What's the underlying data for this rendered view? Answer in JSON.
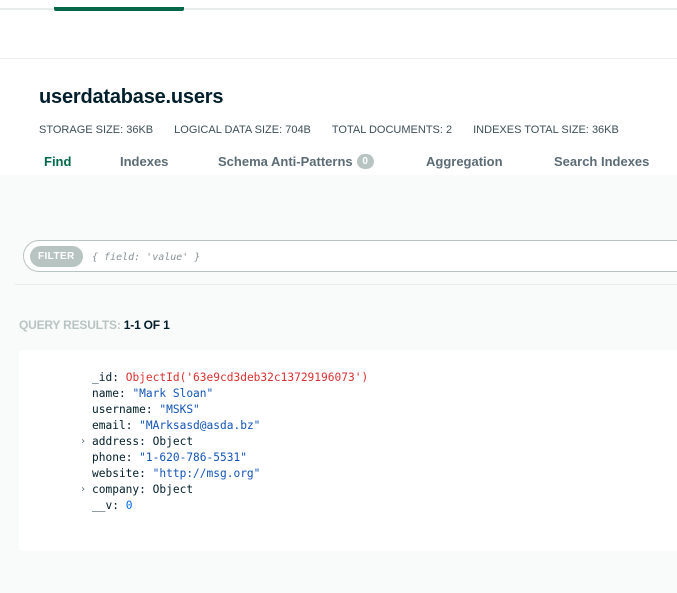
{
  "collection": {
    "namespace": "userdatabase.users",
    "stats": [
      {
        "label": "STORAGE SIZE:",
        "value": "36KB"
      },
      {
        "label": "LOGICAL DATA SIZE:",
        "value": "704B"
      },
      {
        "label": "TOTAL DOCUMENTS:",
        "value": "2"
      },
      {
        "label": "INDEXES TOTAL SIZE:",
        "value": "36KB"
      }
    ]
  },
  "tabs": [
    {
      "label": "Find",
      "active": true
    },
    {
      "label": "Indexes",
      "active": false
    },
    {
      "label": "Schema Anti-Patterns",
      "badge": "0",
      "active": false
    },
    {
      "label": "Aggregation",
      "active": false
    },
    {
      "label": "Search Indexes",
      "active": false
    }
  ],
  "filter": {
    "label": "FILTER",
    "placeholder": "{ field: 'value' }"
  },
  "results": {
    "label": "QUERY RESULTS:",
    "count": "1-1 OF 1"
  },
  "document": {
    "fields": [
      {
        "key": "_id",
        "value": "ObjectId('63e9cd3deb32c13729196073')",
        "kind": "objectid",
        "expandable": false
      },
      {
        "key": "name",
        "value": "\"Mark Sloan\"",
        "kind": "string",
        "expandable": false
      },
      {
        "key": "username",
        "value": "\"MSKS\"",
        "kind": "string",
        "expandable": false
      },
      {
        "key": "email",
        "value": "\"MArksasd@asda.bz\"",
        "kind": "string",
        "expandable": false
      },
      {
        "key": "address",
        "value": "Object",
        "kind": "object",
        "expandable": true
      },
      {
        "key": "phone",
        "value": "\"1-620-786-5531\"",
        "kind": "string",
        "expandable": false
      },
      {
        "key": "website",
        "value": "\"http://msg.org\"",
        "kind": "string",
        "expandable": false
      },
      {
        "key": "company",
        "value": "Object",
        "kind": "object",
        "expandable": true
      },
      {
        "key": "__v",
        "value": "0",
        "kind": "number",
        "expandable": false
      }
    ]
  },
  "colors": {
    "accent": "#00684a",
    "string": "#1254b7",
    "objectid": "#db3030",
    "number": "#016bf8",
    "muted": "#b8c4c2"
  }
}
